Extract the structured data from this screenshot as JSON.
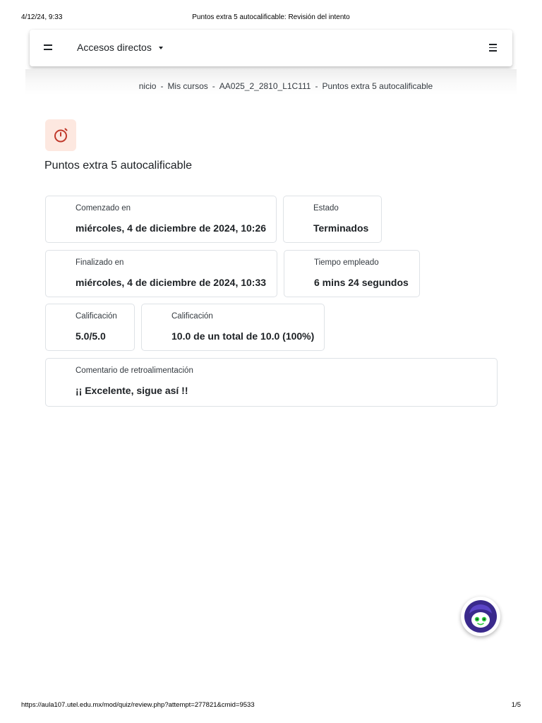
{
  "print_header": {
    "datetime": "4/12/24, 9:33",
    "document_title": "Puntos extra 5 autocalificable: Revisión del intento"
  },
  "navbar": {
    "title": "Accesos directos",
    "left_icon": "menu-lines-icon",
    "right_icon": "hamburger-icon"
  },
  "breadcrumb": {
    "items": [
      "nicio",
      "Mis cursos",
      "AA025_2_2810_L1C111",
      "Puntos extra 5 autocalificable"
    ],
    "separator": "-"
  },
  "activity": {
    "icon": "stopwatch-icon",
    "icon_color": "#c0392b",
    "icon_bg": "#fde8e0",
    "title": "Puntos extra 5 autocalificable"
  },
  "summary": {
    "started": {
      "label": "Comenzado en",
      "value": "miércoles, 4 de diciembre de 2024, 10:26"
    },
    "state": {
      "label": "Estado",
      "value": "Terminados"
    },
    "finished": {
      "label": "Finalizado en",
      "value": "miércoles, 4 de diciembre de 2024, 10:33"
    },
    "time_taken": {
      "label": "Tiempo empleado",
      "value": "6 mins 24 segundos"
    },
    "marks": {
      "label": "Calificación",
      "value": "5.0/5.0"
    },
    "grade": {
      "label": "Calificación",
      "value": "10.0 de un total de 10.0 (100%)"
    },
    "feedback": {
      "label": "Comentario de retroalimentación",
      "value": "¡¡ Excelente, sigue así !!"
    }
  },
  "print_footer": {
    "url": "https://aula107.utel.edu.mx/mod/quiz/review.php?attempt=277821&cmid=9533",
    "page": "1/5"
  },
  "chat_bot": {
    "icon": "chatbot-avatar-icon"
  }
}
